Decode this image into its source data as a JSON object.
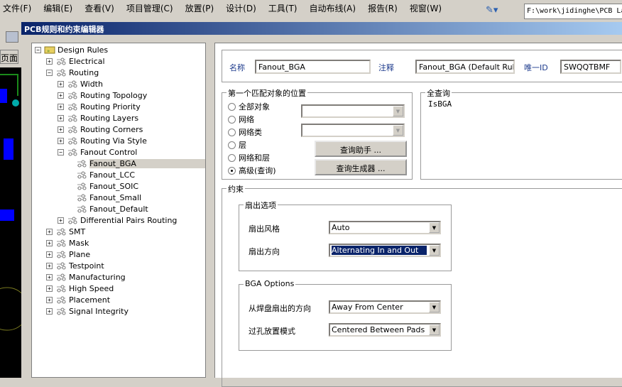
{
  "menubar": [
    "文件(F)",
    "编辑(E)",
    "查看(V)",
    "项目管理(C)",
    "放置(P)",
    "设计(D)",
    "工具(T)",
    "自动布线(A)",
    "报告(R)",
    "视窗(W)"
  ],
  "path": "F:\\work\\jidinghe\\PCB La",
  "left_tab": "页面",
  "dialog_title": "PCB规则和约束编辑器",
  "tree": [
    {
      "label": "Design Rules",
      "level": 0,
      "exp": "-"
    },
    {
      "label": "Electrical",
      "level": 1,
      "exp": "+"
    },
    {
      "label": "Routing",
      "level": 1,
      "exp": "-"
    },
    {
      "label": "Width",
      "level": 2,
      "exp": "+"
    },
    {
      "label": "Routing Topology",
      "level": 2,
      "exp": "+"
    },
    {
      "label": "Routing Priority",
      "level": 2,
      "exp": "+"
    },
    {
      "label": "Routing Layers",
      "level": 2,
      "exp": "+"
    },
    {
      "label": "Routing Corners",
      "level": 2,
      "exp": "+"
    },
    {
      "label": "Routing Via Style",
      "level": 2,
      "exp": "+"
    },
    {
      "label": "Fanout Control",
      "level": 2,
      "exp": "-"
    },
    {
      "label": "Fanout_BGA",
      "level": 3,
      "exp": "",
      "selected": true
    },
    {
      "label": "Fanout_LCC",
      "level": 3,
      "exp": ""
    },
    {
      "label": "Fanout_SOIC",
      "level": 3,
      "exp": ""
    },
    {
      "label": "Fanout_Small",
      "level": 3,
      "exp": ""
    },
    {
      "label": "Fanout_Default",
      "level": 3,
      "exp": ""
    },
    {
      "label": "Differential Pairs Routing",
      "level": 2,
      "exp": "+"
    },
    {
      "label": "SMT",
      "level": 1,
      "exp": "+"
    },
    {
      "label": "Mask",
      "level": 1,
      "exp": "+"
    },
    {
      "label": "Plane",
      "level": 1,
      "exp": "+"
    },
    {
      "label": "Testpoint",
      "level": 1,
      "exp": "+"
    },
    {
      "label": "Manufacturing",
      "level": 1,
      "exp": "+"
    },
    {
      "label": "High Speed",
      "level": 1,
      "exp": "+"
    },
    {
      "label": "Placement",
      "level": 1,
      "exp": "+"
    },
    {
      "label": "Signal Integrity",
      "level": 1,
      "exp": "+"
    }
  ],
  "rule": {
    "name_label": "名称",
    "name": "Fanout_BGA",
    "comment_label": "注释",
    "comment": "Fanout_BGA (Default Rule)",
    "id_label": "唯一ID",
    "id": "SWQQTBMF"
  },
  "match": {
    "title": "第一个匹配对象的位置",
    "options": [
      "全部对象",
      "网络",
      "网络类",
      "层",
      "网络和层",
      "高级(查询)"
    ],
    "selected": 5,
    "btn_helper": "查询助手 ...",
    "btn_builder": "查询生成器 ..."
  },
  "query": {
    "title": "全查询",
    "text": "IsBGA"
  },
  "constraints": {
    "title": "约束",
    "fanout": {
      "title": "扇出选项",
      "style_label": "扇出风格",
      "style": "Auto",
      "dir_label": "扇出方向",
      "dir": "Alternating In and Out"
    },
    "bga": {
      "title": "BGA Options",
      "pad_dir_label": "从焊盘扇出的方向",
      "pad_dir": "Away From Center",
      "via_label": "过孔放置模式",
      "via": "Centered Between Pads"
    }
  }
}
